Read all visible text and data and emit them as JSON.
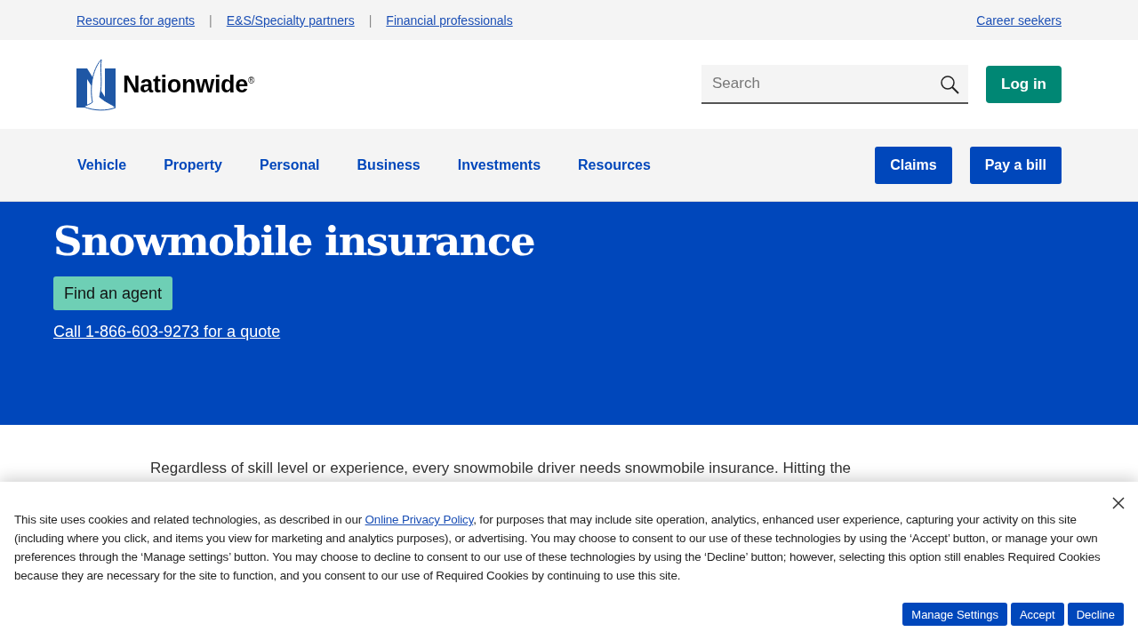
{
  "utility_links": [
    {
      "label": "Resources for agents"
    },
    {
      "label": "E&S/Specialty partners"
    },
    {
      "label": "Financial professionals"
    }
  ],
  "utility_separator": "|",
  "career_link": "Career seekers",
  "logo": {
    "text": "Nationwide$^{®}$"
  },
  "search": {
    "placeholder": "Search"
  },
  "login_button": "Log in",
  "nav_items": [
    {
      "label": "Vehicle"
    },
    {
      "label": "Property"
    },
    {
      "label": "Personal"
    },
    {
      "label": "Business"
    },
    {
      "label": "Investments"
    },
    {
      "label": "Resources"
    }
  ],
  "nav_buttons": [
    "Claims",
    "Pay a bill"
  ],
  "hero": {
    "title": "Snowmobile insurance",
    "agent_button": "Find an agent",
    "phone_link": "Call 1-866-603-9273 for a quote"
  },
  "intro": "Regardless of skill level or experience, every snowmobile driver needs snowmobile insurance. Hitting the",
  "cookie_banner": {
    "text_before": "This site uses cookies and related technologies, as described in our ",
    "link": "Online Privacy Policy",
    "text_after": ", for purposes that may include site operation, analytics, enhanced user experience, capturing your activity on this site (including where you click, and items you view for marketing and analytics purposes), or advertising. You may choose to consent to our use of these technologies by using the ‘Accept’ button, or manage your own preferences through the ‘Manage settings’ button. You may choose to decline to consent to our use of these technologies by using the ‘Decline’ button; however, selecting this option still enables Required Cookies because they are necessary for the site to function, and you consent to our use of Required Cookies by continuing to use this site.",
    "buttons": [
      "Manage Settings",
      "Accept",
      "Decline"
    ]
  }
}
